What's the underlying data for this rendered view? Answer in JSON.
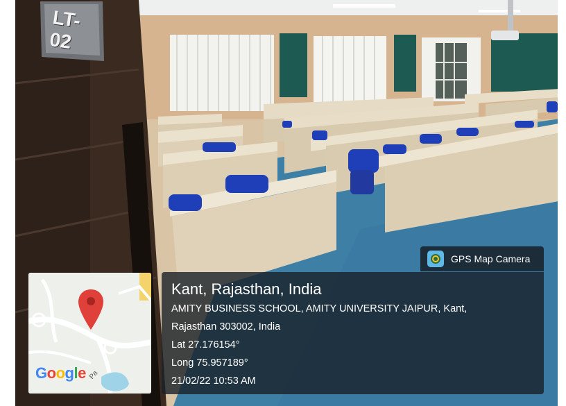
{
  "room_sign": "LT-02",
  "badge": {
    "label": "GPS Map Camera",
    "icon": "gps-map-camera-icon"
  },
  "location": {
    "title": "Kant, Rajasthan, India",
    "address_line1": "AMITY BUSINESS SCHOOL, AMITY UNIVERSITY JAIPUR, Kant,",
    "address_line2": "Rajasthan 303002, India",
    "lat": "Lat 27.176154°",
    "long": "Long 75.957189°",
    "datetime": "21/02/22 10:53 AM"
  },
  "map": {
    "logo": "Google",
    "road_label": "Pa",
    "pin_icon": "map-pin-icon"
  },
  "colors": {
    "overlay": "#192028",
    "pin": "#e0403a",
    "carpet": "#3e7fa6",
    "desk": "#e8dcc4",
    "chair": "#1f3fb8",
    "board": "#1d5a52"
  }
}
